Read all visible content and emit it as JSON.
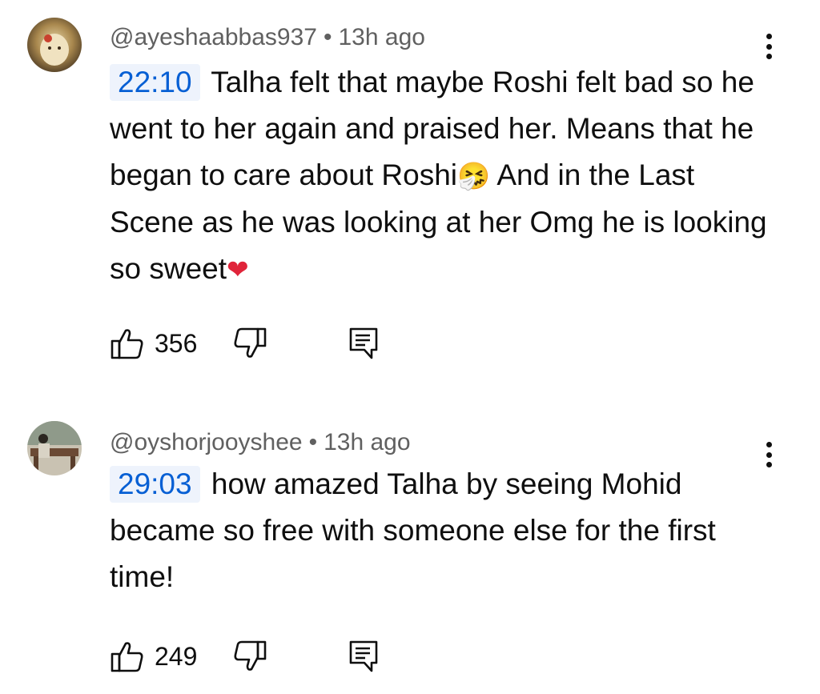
{
  "comments": [
    {
      "handle": "@ayeshaabbas937",
      "separator": "•",
      "time": "13h ago",
      "timestamp": "22:10",
      "text_parts": [
        " Talha felt that maybe Roshi felt bad so he went to her again and praised her. Means that he began to care about Roshi",
        " And in the Last Scene as he was looking at her Omg he is looking so sweet"
      ],
      "emojis": [
        "🤧",
        "❤"
      ],
      "likes": "356"
    },
    {
      "handle": "@oyshorjooyshee",
      "separator": "•",
      "time": "13h ago",
      "timestamp": "29:03",
      "text": " how amazed Talha by seeing Mohid became so free with someone else for the first time!",
      "likes": "249"
    }
  ],
  "icons": {
    "like": "thumb-up-icon",
    "dislike": "thumb-down-icon",
    "reply": "comment-reply-icon",
    "more": "more-vert-icon"
  }
}
